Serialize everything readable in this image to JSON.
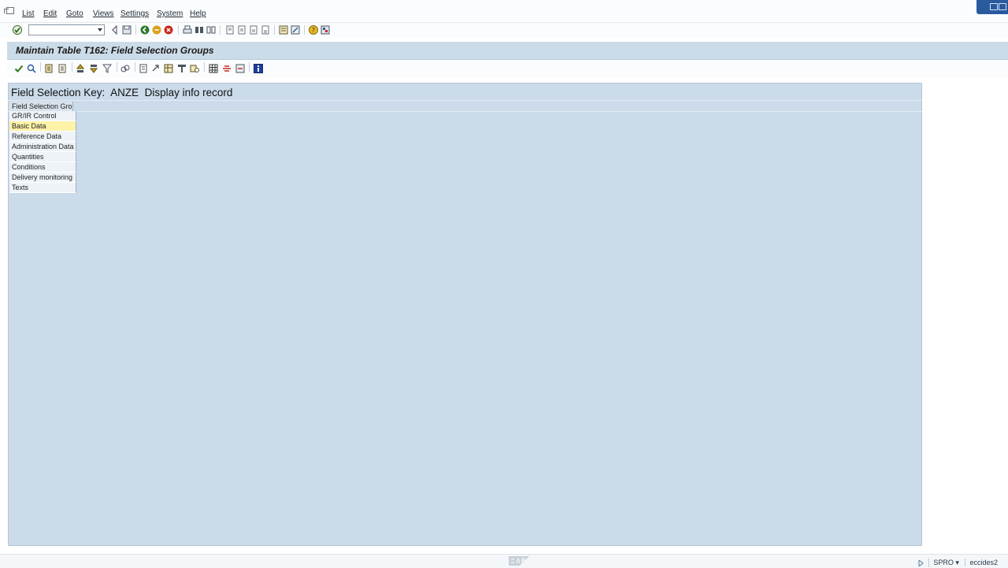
{
  "menu": {
    "items": [
      "List",
      "Edit",
      "Goto",
      "Views",
      "Settings",
      "System",
      "Help"
    ]
  },
  "toolbar": {
    "command_field_value": ""
  },
  "title": "Maintain Table T162: Field Selection Groups",
  "heading": {
    "label": "Field Selection Key:",
    "key": "ANZE",
    "description": "Display info record"
  },
  "list": {
    "header": "Field Selection Gro",
    "rows": [
      "GR/IR Control",
      "Basic Data",
      "Reference Data",
      "Administration Data",
      "Quantities",
      "Conditions",
      "Delivery monitoring",
      "Texts"
    ],
    "selected_index": 1
  },
  "status": {
    "transaction": "SPRO",
    "server": "eccides2"
  },
  "colors": {
    "panel": "#cbdbea",
    "title_bar": "#cbdbe8",
    "selected_row": "#fdf2a8"
  }
}
